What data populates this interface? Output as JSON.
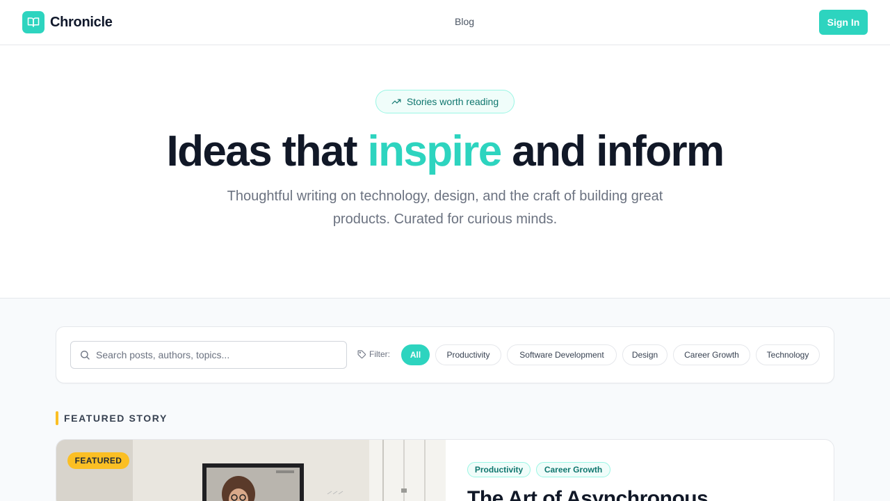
{
  "header": {
    "brand": "Chronicle",
    "nav": [
      "Blog"
    ],
    "sign_in": "Sign In"
  },
  "hero": {
    "badge": "Stories worth reading",
    "title_before": "Ideas that ",
    "title_accent": "inspire",
    "title_after": " and inform",
    "subtitle": "Thoughtful writing on technology, design, and the craft of building great products. Curated for curious minds."
  },
  "filters": {
    "search_placeholder": "Search posts, authors, topics...",
    "label": "Filter:",
    "chips": [
      "All",
      "Productivity",
      "Software Development",
      "Design",
      "Career Growth",
      "Technology"
    ],
    "active": "All"
  },
  "featured": {
    "section_label": "FEATURED STORY",
    "badge": "FEATURED",
    "tags": [
      "Productivity",
      "Career Growth"
    ],
    "title": "The Art of Asynchronous"
  },
  "colors": {
    "accent": "#2dd4bf",
    "featured": "#fbbf24",
    "text": "#111827"
  },
  "icons": {
    "logo": "open-book-icon",
    "badge": "trending-up-icon",
    "search": "search-icon",
    "filter": "tag-icon"
  }
}
